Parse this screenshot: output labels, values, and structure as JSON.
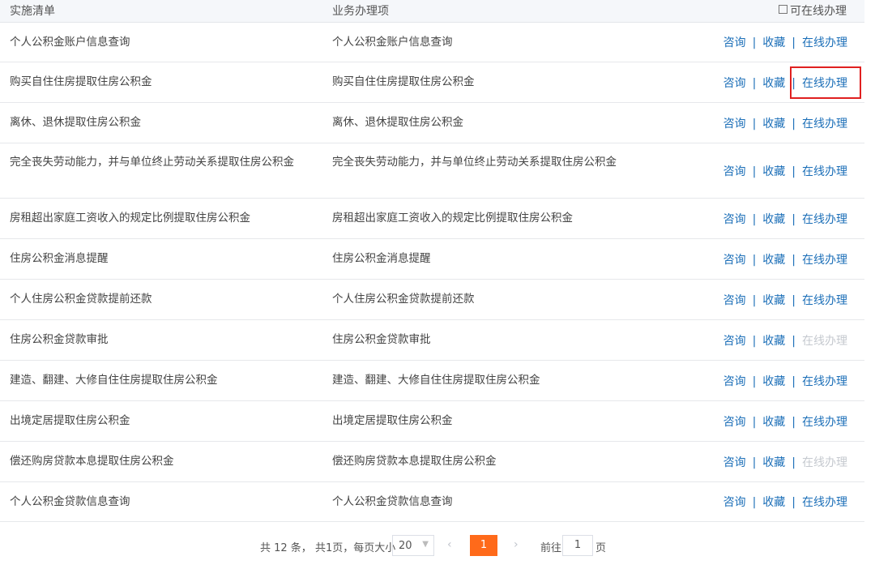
{
  "header": {
    "col1": "实施清单",
    "col2": "业务办理项",
    "online_filter": "可在线办理"
  },
  "rows": [
    {
      "name": "个人公积金账户信息查询",
      "item": "个人公积金账户信息查询",
      "consult": "咨询",
      "fav": "收藏",
      "online": "在线办理",
      "online_enabled": true
    },
    {
      "name": "购买自住住房提取住房公积金",
      "item": "购买自住住房提取住房公积金",
      "consult": "咨询",
      "fav": "收藏",
      "online": "在线办理",
      "online_enabled": true
    },
    {
      "name": "离休、退休提取住房公积金",
      "item": "离休、退休提取住房公积金",
      "consult": "咨询",
      "fav": "收藏",
      "online": "在线办理",
      "online_enabled": true
    },
    {
      "name": "完全丧失劳动能力，并与单位终止劳动关系提取住房公积金",
      "item": "完全丧失劳动能力，并与单位终止劳动关系提取住房公积金",
      "consult": "咨询",
      "fav": "收藏",
      "online": "在线办理",
      "online_enabled": true
    },
    {
      "name": "房租超出家庭工资收入的规定比例提取住房公积金",
      "item": "房租超出家庭工资收入的规定比例提取住房公积金",
      "consult": "咨询",
      "fav": "收藏",
      "online": "在线办理",
      "online_enabled": true
    },
    {
      "name": "住房公积金消息提醒",
      "item": "住房公积金消息提醒",
      "consult": "咨询",
      "fav": "收藏",
      "online": "在线办理",
      "online_enabled": true
    },
    {
      "name": "个人住房公积金贷款提前还款",
      "item": "个人住房公积金贷款提前还款",
      "consult": "咨询",
      "fav": "收藏",
      "online": "在线办理",
      "online_enabled": true
    },
    {
      "name": "住房公积金贷款审批",
      "item": "住房公积金贷款审批",
      "consult": "咨询",
      "fav": "收藏",
      "online": "在线办理",
      "online_enabled": false
    },
    {
      "name": "建造、翻建、大修自住住房提取住房公积金",
      "item": "建造、翻建、大修自住住房提取住房公积金",
      "consult": "咨询",
      "fav": "收藏",
      "online": "在线办理",
      "online_enabled": true
    },
    {
      "name": "出境定居提取住房公积金",
      "item": "出境定居提取住房公积金",
      "consult": "咨询",
      "fav": "收藏",
      "online": "在线办理",
      "online_enabled": true
    },
    {
      "name": "偿还购房贷款本息提取住房公积金",
      "item": "偿还购房贷款本息提取住房公积金",
      "consult": "咨询",
      "fav": "收藏",
      "online": "在线办理",
      "online_enabled": false
    },
    {
      "name": "个人公积金贷款信息查询",
      "item": "个人公积金贷款信息查询",
      "consult": "咨询",
      "fav": "收藏",
      "online": "在线办理",
      "online_enabled": true
    }
  ],
  "pagination": {
    "total": "共 12 条，",
    "pages": "共1页，每页大小",
    "page_size": "20",
    "prev": "‹",
    "current": "1",
    "next": "›",
    "goto_label": "前往",
    "goto_value": "1",
    "goto_suffix": "页"
  },
  "colors": {
    "link": "#1c6fb8",
    "disabled": "#c5c9cf",
    "active_page": "#ff6a1a",
    "highlight": "#e02020"
  }
}
